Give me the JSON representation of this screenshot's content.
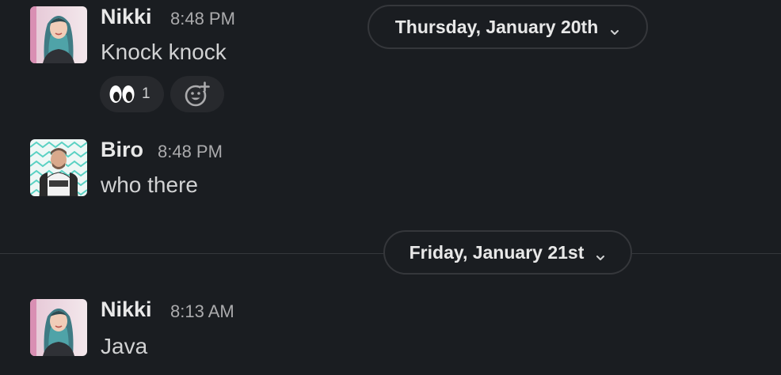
{
  "messages": [
    {
      "author": "Nikki",
      "time": "8:48 PM",
      "text": "Knock knock",
      "reactions": [
        {
          "emoji": "eyes",
          "count": "1"
        }
      ]
    },
    {
      "author": "Biro",
      "time": "8:48 PM",
      "text": "who there"
    },
    {
      "author": "Nikki",
      "time": "8:13 AM",
      "text": "Java"
    }
  ],
  "date_dividers": [
    {
      "label": "Thursday, January 20th"
    },
    {
      "label": "Friday, January 21st"
    }
  ],
  "icons": {
    "add_reaction": "add-reaction-icon",
    "date_dropdown": "chevron-down-icon"
  },
  "colors": {
    "background": "#1a1d21",
    "author": "#e8e8e8",
    "timestamp": "#ababad",
    "reaction_bg": "#27292d",
    "divider": "#35373b"
  }
}
